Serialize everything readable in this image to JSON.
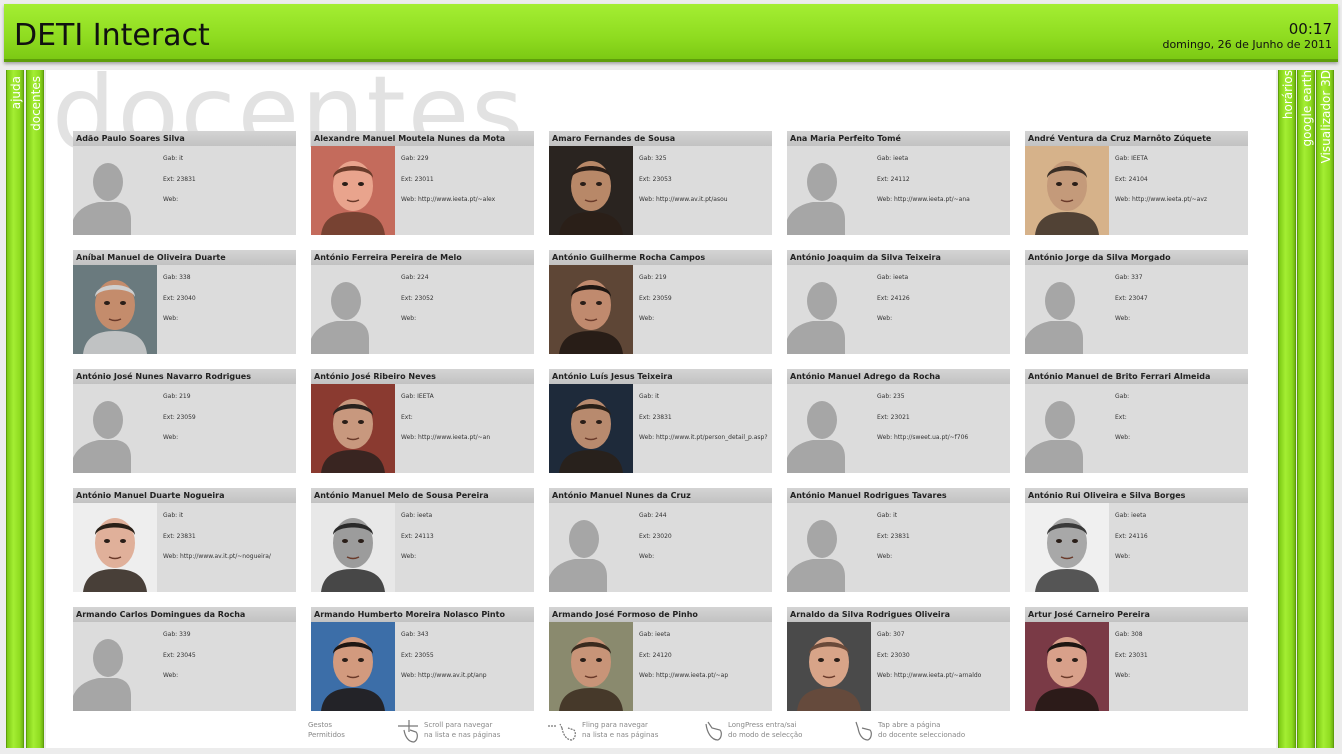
{
  "header": {
    "title": "DETI Interact",
    "time": "00:17",
    "date": "domingo, 26 de Junho de 2011"
  },
  "left_tabs": [
    "ajuda",
    "docentes"
  ],
  "right_tabs": [
    "horários",
    "google earth",
    "Visualizador 3D"
  ],
  "page_word": "docentes",
  "labels": {
    "gab": "Gab:",
    "ext": "Ext:",
    "web": "Web:"
  },
  "teachers": [
    {
      "name": "Adão Paulo Soares Silva",
      "gab": "it",
      "ext": "23831",
      "web": "",
      "photo": "placeholder"
    },
    {
      "name": "Alexandre Manuel Moutela Nunes da Mota",
      "gab": "229",
      "ext": "23011",
      "web": "http://www.ieeta.pt/~alex",
      "photo": "face-pink"
    },
    {
      "name": "Amaro Fernandes de Sousa",
      "gab": "325",
      "ext": "23053",
      "web": "http://www.av.it.pt/asou",
      "photo": "face-dark"
    },
    {
      "name": "Ana Maria Perfeito Tomé",
      "gab": "ieeta",
      "ext": "24112",
      "web": "http://www.ieeta.pt/~ana",
      "photo": "placeholder"
    },
    {
      "name": "André Ventura da Cruz Marnôto Zúquete",
      "gab": "IEETA",
      "ext": "24104",
      "web": "http://www.ieeta.pt/~avz",
      "photo": "face-warm"
    },
    {
      "name": "Aníbal Manuel de Oliveira Duarte",
      "gab": "338",
      "ext": "23040",
      "web": "",
      "photo": "face-grey"
    },
    {
      "name": "António Ferreira Pereira de Melo",
      "gab": "224",
      "ext": "23052",
      "web": "",
      "photo": "placeholder"
    },
    {
      "name": "António Guilherme Rocha Campos",
      "gab": "219",
      "ext": "23059",
      "web": "",
      "photo": "face-brown"
    },
    {
      "name": "António Joaquim da Silva Teixeira",
      "gab": "ieeta",
      "ext": "24126",
      "web": "",
      "photo": "placeholder"
    },
    {
      "name": "António Jorge da Silva Morgado",
      "gab": "337",
      "ext": "23047",
      "web": "",
      "photo": "placeholder"
    },
    {
      "name": "António José Nunes Navarro Rodrigues",
      "gab": "219",
      "ext": "23059",
      "web": "",
      "photo": "placeholder"
    },
    {
      "name": "António José Ribeiro Neves",
      "gab": "IEETA",
      "ext": "",
      "web": "http://www.ieeta.pt/~an",
      "photo": "face-red"
    },
    {
      "name": "António Luís Jesus Teixeira",
      "gab": "it",
      "ext": "23831",
      "web": "http://www.it.pt/person_detail_p.asp?",
      "photo": "face-navy"
    },
    {
      "name": "António Manuel Adrego da Rocha",
      "gab": "235",
      "ext": "23021",
      "web": "http://sweet.ua.pt/~f706",
      "photo": "placeholder"
    },
    {
      "name": "António Manuel de Brito Ferrari Almeida",
      "gab": "",
      "ext": "",
      "web": "",
      "photo": "placeholder"
    },
    {
      "name": "António Manuel Duarte Nogueira",
      "gab": "it",
      "ext": "23831",
      "web": "http://www.av.it.pt/~nogueira/",
      "photo": "face-white"
    },
    {
      "name": "António Manuel Melo de Sousa Pereira",
      "gab": "ieeta",
      "ext": "24113",
      "web": "",
      "photo": "face-bw"
    },
    {
      "name": "António Manuel Nunes da Cruz",
      "gab": "244",
      "ext": "23020",
      "web": "",
      "photo": "placeholder"
    },
    {
      "name": "António Manuel Rodrigues Tavares",
      "gab": "it",
      "ext": "23831",
      "web": "",
      "photo": "placeholder"
    },
    {
      "name": "António Rui Oliveira e Silva Borges",
      "gab": "ieeta",
      "ext": "24116",
      "web": "",
      "photo": "face-bw2"
    },
    {
      "name": "Armando Carlos Domingues da Rocha",
      "gab": "339",
      "ext": "23045",
      "web": "",
      "photo": "placeholder"
    },
    {
      "name": "Armando Humberto Moreira Nolasco Pinto",
      "gab": "343",
      "ext": "23055",
      "web": "http://www.av.it.pt/anp",
      "photo": "face-blue"
    },
    {
      "name": "Armando José Formoso de Pinho",
      "gab": "ieeta",
      "ext": "24120",
      "web": "http://www.ieeta.pt/~ap",
      "photo": "face-olive"
    },
    {
      "name": "Arnaldo da Silva Rodrigues Oliveira",
      "gab": "307",
      "ext": "23030",
      "web": "http://www.ieeta.pt/~arnaldo",
      "photo": "face-bald"
    },
    {
      "name": "Artur José Carneiro Pereira",
      "gab": "308",
      "ext": "23031",
      "web": "",
      "photo": "face-maroon"
    }
  ],
  "gestures": {
    "title": [
      "Gestos",
      "Permitidos"
    ],
    "items": [
      {
        "icon": "scroll-gesture-icon",
        "lines": [
          "Scroll para navegar",
          "na lista e nas páginas"
        ]
      },
      {
        "icon": "fling-gesture-icon",
        "lines": [
          "Fling para navegar",
          "na lista e nas páginas"
        ]
      },
      {
        "icon": "longpress-gesture-icon",
        "lines": [
          "LongPress entra/sai",
          "do modo de selecção"
        ]
      },
      {
        "icon": "tap-gesture-icon",
        "lines": [
          "Tap abre a página",
          "do docente seleccionado"
        ]
      }
    ]
  },
  "colors": {
    "accent": "#8fdc20",
    "card": "#dcdcdc",
    "placeholder": "#a6a6a6"
  }
}
